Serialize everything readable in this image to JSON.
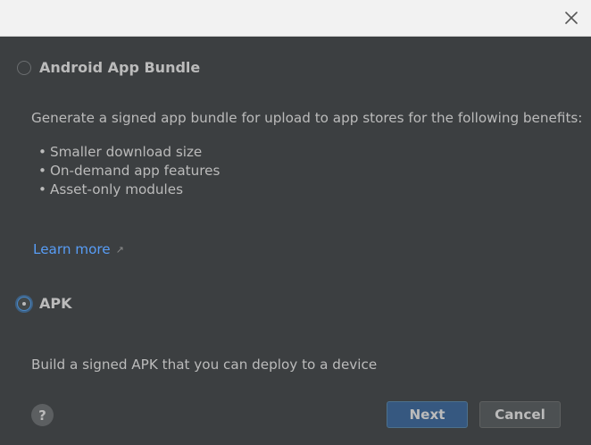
{
  "titlebar": {
    "close_icon": "close-icon"
  },
  "options": {
    "aab": {
      "label": "Android App Bundle",
      "selected": false,
      "description": "Generate a signed app bundle for upload to app stores for the following benefits:",
      "benefits": [
        "Smaller download size",
        "On-demand app features",
        "Asset-only modules"
      ],
      "learn_more": "Learn more",
      "learn_more_icon": "external-link-arrow-icon"
    },
    "apk": {
      "label": "APK",
      "selected": true,
      "description": "Build a signed APK that you can deploy to a device"
    }
  },
  "footer": {
    "help_label": "?",
    "next_label": "Next",
    "cancel_label": "Cancel"
  },
  "colors": {
    "background": "#3c3f41",
    "titlebar": "#f2f2f2",
    "text": "#bbbbbb",
    "link": "#589df6",
    "primary_button": "#365880",
    "secondary_button": "#4c5052"
  }
}
